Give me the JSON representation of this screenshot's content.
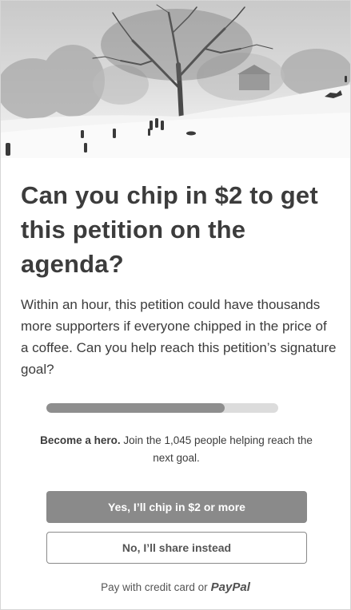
{
  "headline": "Can you chip in $2 to get this petition on the agenda?",
  "body": "Within an hour, this petition could have thousands more supporters if everyone chipped in the price of a coffee. Can you help reach this petition’s signature goal?",
  "progress": {
    "fraction": 0.77
  },
  "note": {
    "strong": "Become a hero.",
    "rest": " Join the 1,045 people helping reach the next goal."
  },
  "buttons": {
    "primary": "Yes, I’ll chip in $2 or more",
    "secondary": "No, I’ll share instead"
  },
  "payment": {
    "prefix": "Pay with credit card or",
    "paypal": "PayPal"
  },
  "colors": {
    "primary_button": "#8a8a8a",
    "progress_fill": "#8e8e8e",
    "progress_track": "#dcdcdc",
    "text": "#3c3c3c"
  }
}
